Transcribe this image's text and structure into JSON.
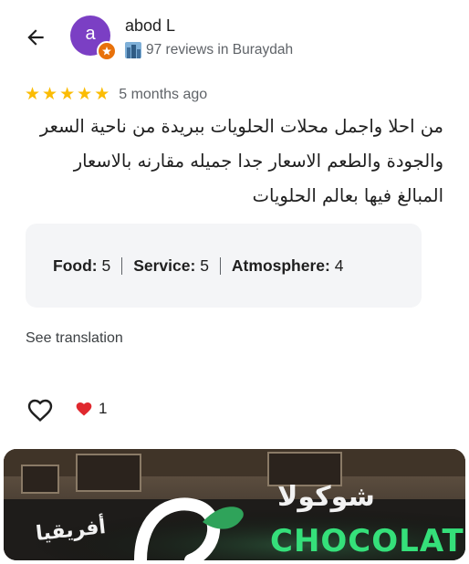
{
  "header": {
    "user_name": "abod L",
    "avatar_initial": "a",
    "reviews_meta": "97 reviews in Buraydah"
  },
  "review": {
    "stars": 5,
    "date": "5 months ago",
    "text": "من احلا واجمل محلات الحلويات ببريدة من ناحية السعر والجودة والطعم الاسعار جدا جميله مقارنه بالاسعار المبالغ فيها بعالم الحلويات"
  },
  "ratings": [
    {
      "label": "Food:",
      "value": "5"
    },
    {
      "label": "Service:",
      "value": "5"
    },
    {
      "label": "Atmosphere:",
      "value": "4"
    }
  ],
  "see_translation": "See translation",
  "reactions": {
    "heart_count": "1"
  },
  "photo": {
    "sign_arabic_right": "شوكولا",
    "sign_latin": "CHOCOLATE",
    "sign_arabic_left": "أفريقيا"
  },
  "colors": {
    "avatar": "#7b3fc4",
    "badge": "#e8710a",
    "star": "#fbbc04",
    "card_bg": "#f4f5f7",
    "neon_green": "#35e07a"
  },
  "icons": [
    "back-arrow-icon",
    "local-guide-badge-icon",
    "city-icon",
    "star-icon",
    "heart-outline-icon",
    "red-heart-icon"
  ]
}
